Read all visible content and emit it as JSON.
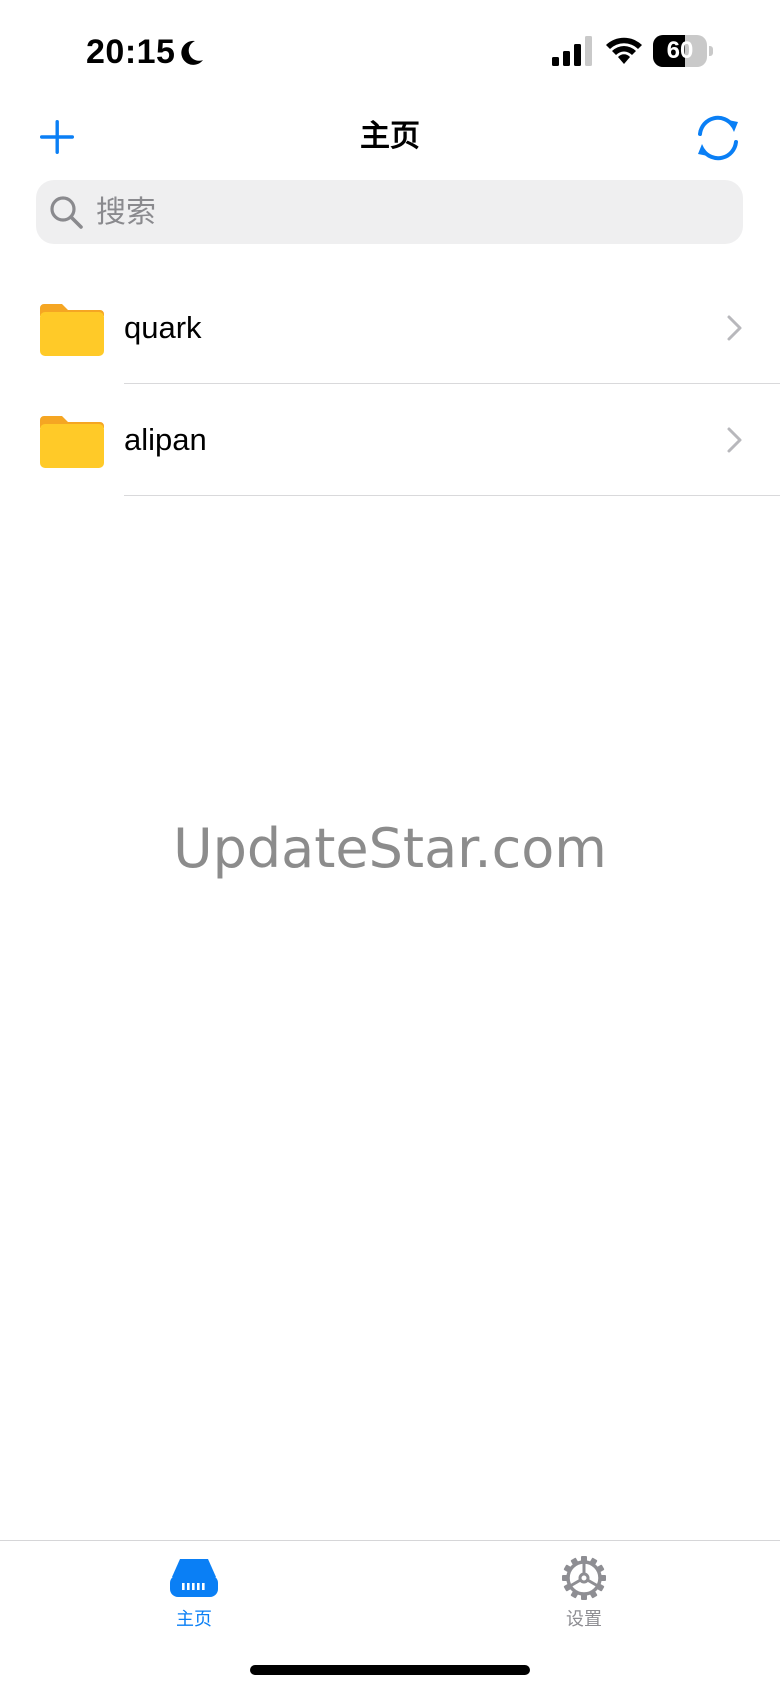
{
  "status_bar": {
    "time": "20:15",
    "battery_percent": 60,
    "battery_text": "60",
    "icons": [
      "moon-icon",
      "signal-icon",
      "wifi-icon",
      "battery-icon"
    ]
  },
  "nav": {
    "title": "主页",
    "left_icon": "plus-icon",
    "right_icon": "sync-icon"
  },
  "search": {
    "placeholder": "搜索",
    "value": ""
  },
  "folders": [
    {
      "label": "quark",
      "icon": "folder-icon"
    },
    {
      "label": "alipan",
      "icon": "folder-icon"
    }
  ],
  "watermark": "UpdateStar.com",
  "tab_bar": {
    "tabs": [
      {
        "label": "主页",
        "icon": "drive-icon",
        "selected": true
      },
      {
        "label": "设置",
        "icon": "gear-icon",
        "selected": false
      }
    ]
  },
  "colors": {
    "accent": "#0a7ff5",
    "folder": "#ffca28",
    "folder_tab": "#f5a623",
    "inactive": "#8e8e93"
  }
}
